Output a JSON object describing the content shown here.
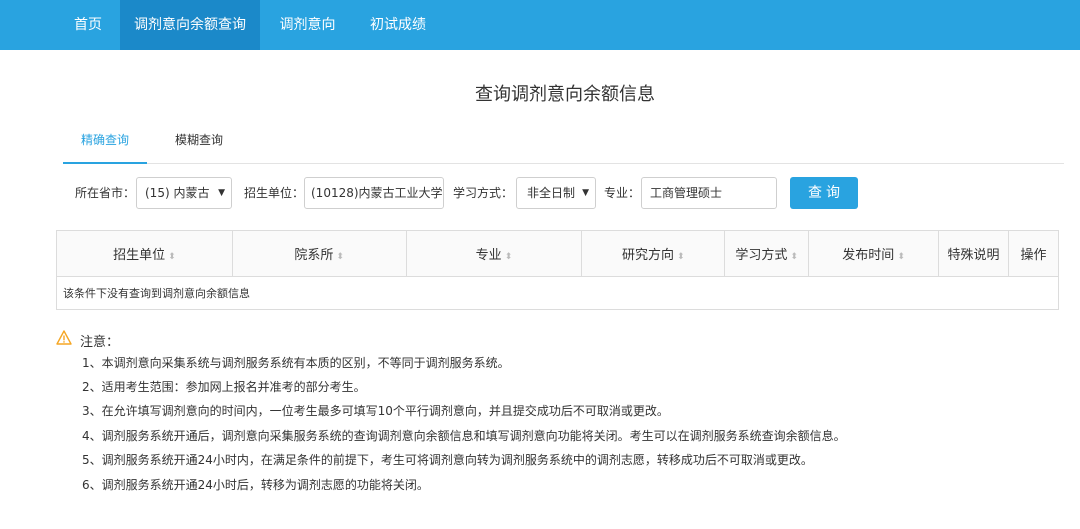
{
  "nav": {
    "items": [
      {
        "label": "首页"
      },
      {
        "label": "调剂意向余额查询"
      },
      {
        "label": "调剂意向"
      },
      {
        "label": "初试成绩"
      }
    ]
  },
  "page_title": "查询调剂意向余额信息",
  "tabs": [
    {
      "label": "精确查询"
    },
    {
      "label": "模糊查询"
    }
  ],
  "form": {
    "province_label": "所在省市：",
    "province_value": "(15) 内蒙古",
    "unit_label": "招生单位：",
    "unit_value": "(10128)内蒙古工业大学",
    "mode_label": "学习方式：",
    "mode_value": "非全日制",
    "major_label": "专业：",
    "major_value": "工商管理硕士",
    "search_label": "查询"
  },
  "table": {
    "headers": [
      "招生单位",
      "院系所",
      "专业",
      "研究方向",
      "学习方式",
      "发布时间",
      "特殊说明",
      "操作"
    ],
    "empty_message": "该条件下没有查询到调剂意向余额信息"
  },
  "notes": {
    "title": "注意：",
    "lines": [
      "1、本调剂意向采集系统与调剂服务系统有本质的区别，不等同于调剂服务系统。",
      "2、适用考生范围：参加网上报名并准考的部分考生。",
      "3、在允许填写调剂意向的时间内，一位考生最多可填写10个平行调剂意向，并且提交成功后不可取消或更改。",
      "4、调剂服务系统开通后，调剂意向采集服务系统的查询调剂意向余额信息和填写调剂意向功能将关闭。考生可以在调剂服务系统查询余额信息。",
      "5、调剂服务系统开通24小时内，在满足条件的前提下，考生可将调剂意向转为调剂服务系统中的调剂志愿，转移成功后不可取消或更改。",
      "6、调剂服务系统开通24小时后，转移为调剂志愿的功能将关闭。"
    ]
  },
  "colors": {
    "nav_bg": "#29a3e0",
    "nav_active": "#1b89c9",
    "accent": "#29a3e0",
    "warning": "#f5a623"
  }
}
